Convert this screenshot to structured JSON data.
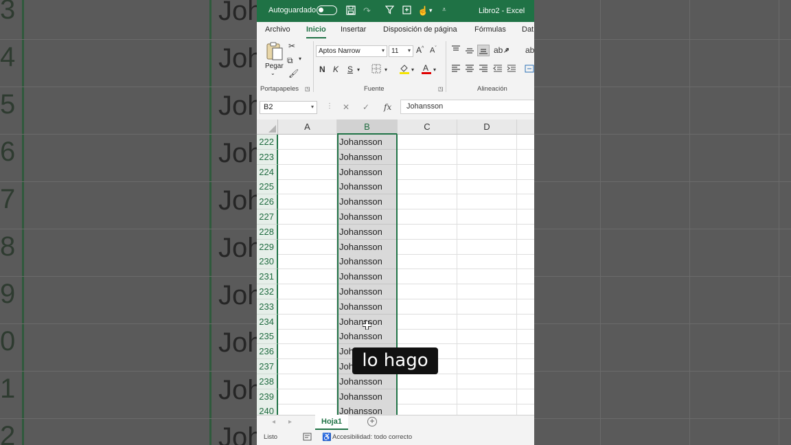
{
  "titlebar": {
    "autosave_label": "Autoguardado",
    "doc_title": "Libro2 - Excel"
  },
  "ribbon_tabs": [
    "Archivo",
    "Inicio",
    "Insertar",
    "Disposición de página",
    "Fórmulas",
    "Dat"
  ],
  "ribbon": {
    "paste_label": "Pegar",
    "clipboard_group": "Portapapeles",
    "font_group": "Fuente",
    "alignment_group": "Alineación",
    "font_name": "Aptos Narrow",
    "font_size": "11",
    "bold": "N",
    "italic": "K",
    "underline": "S"
  },
  "formula_bar": {
    "name_box": "B2",
    "fx": "fx",
    "value": "Johansson"
  },
  "grid": {
    "columns": [
      "A",
      "B",
      "C",
      "D"
    ],
    "selected_column": "B",
    "rows": [
      {
        "num": "222",
        "b": "Johansson"
      },
      {
        "num": "223",
        "b": "Johansson"
      },
      {
        "num": "224",
        "b": "Johansson"
      },
      {
        "num": "225",
        "b": "Johansson"
      },
      {
        "num": "226",
        "b": "Johansson"
      },
      {
        "num": "227",
        "b": "Johansson"
      },
      {
        "num": "228",
        "b": "Johansson"
      },
      {
        "num": "229",
        "b": "Johansson"
      },
      {
        "num": "230",
        "b": "Johansson"
      },
      {
        "num": "231",
        "b": "Johansson"
      },
      {
        "num": "232",
        "b": "Johansson"
      },
      {
        "num": "233",
        "b": "Johansson"
      },
      {
        "num": "234",
        "b": "Johansson"
      },
      {
        "num": "235",
        "b": "Johansson"
      },
      {
        "num": "236",
        "b": "Johansson"
      },
      {
        "num": "237",
        "b": "Johansson"
      },
      {
        "num": "238",
        "b": "Johansson"
      },
      {
        "num": "239",
        "b": "Johansson"
      },
      {
        "num": "240",
        "b": "Johansson"
      }
    ]
  },
  "sheets": {
    "active": "Hoja1",
    "add_symbol": "+"
  },
  "status": {
    "ready": "Listo",
    "accessibility": "Accesibilidad: todo correcto"
  },
  "caption": "lo hago",
  "background": {
    "left_numbers": [
      "3",
      "4",
      "5",
      "6",
      "7",
      "8",
      "9",
      "0",
      "1",
      "2"
    ],
    "right_text": "Joh"
  },
  "colors": {
    "accent": "#1f7245",
    "selection_fill": "#d9d9d9"
  }
}
